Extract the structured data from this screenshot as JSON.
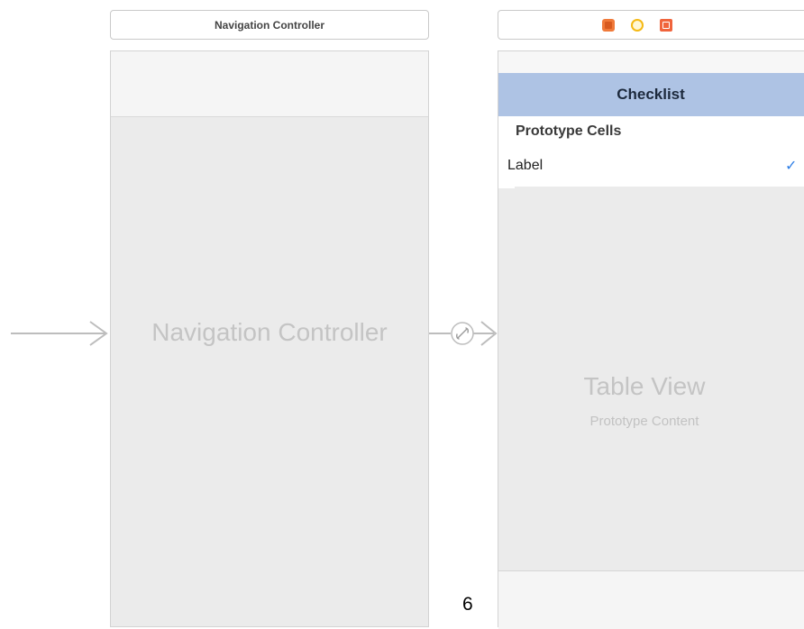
{
  "nav_scene": {
    "header_title": "Navigation Controller",
    "placeholder": "Navigation Controller"
  },
  "table_scene": {
    "header_icons": [
      "cube-icon",
      "first-responder-icon",
      "exit-icon"
    ],
    "navbar_title": "Checklist",
    "section_header": "Prototype Cells",
    "cell_label": "Label",
    "cell_accessory": "✓",
    "placeholder_title": "Table View",
    "placeholder_subtitle": "Prototype Content"
  },
  "page": {
    "number": "6"
  },
  "colors": {
    "canvas_bg": "#ffffff",
    "scene_bg": "#ebebeb",
    "navbar_bg": "#aec3e4",
    "checkmark": "#2f7fe6",
    "placeholder_text": "#c4c4c4"
  }
}
